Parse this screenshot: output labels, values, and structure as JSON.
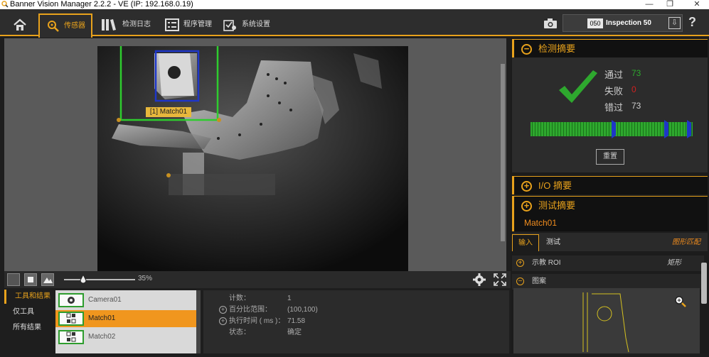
{
  "window": {
    "title": "Banner Vision Manager 2.2.2 - VE (IP: 192.168.0.19)",
    "minimize": "—",
    "restore": "❐",
    "close": "✕"
  },
  "toolbar": {
    "tabs": [
      {
        "label": "",
        "icon": "home-icon"
      },
      {
        "label": "传感器",
        "icon": "sensor-search-icon"
      },
      {
        "label": "检测日志",
        "icon": "log-books-icon"
      },
      {
        "label": "程序管理",
        "icon": "program-list-icon"
      },
      {
        "label": "系统设置",
        "icon": "system-settings-icon"
      }
    ],
    "inspection_number": "050",
    "inspection_name": "Inspection 50",
    "download": "⇩",
    "help": "?"
  },
  "viewer": {
    "roi_label": "[1] Match01",
    "zoom": "35%"
  },
  "left_tabs": [
    "工具和结果",
    "仅工具",
    "所有结果"
  ],
  "tools": [
    {
      "name": "Camera01",
      "icon": "camera-tool-icon"
    },
    {
      "name": "Match01",
      "icon": "match-tool-icon"
    },
    {
      "name": "Match02",
      "icon": "match-tool-icon"
    }
  ],
  "tool_detail": [
    {
      "key": "计数：",
      "value": "1",
      "expand": false
    },
    {
      "key": "百分比范围：",
      "value": "(100,100)",
      "expand": true
    },
    {
      "key": "执行时间 ( ms )：",
      "value": "71.58",
      "expand": true
    },
    {
      "key": "状态：",
      "value": "确定",
      "expand": false
    }
  ],
  "summary": {
    "title": "检测摘要",
    "pass_label": "通过",
    "pass_value": "73",
    "fail_label": "失败",
    "fail_value": "0",
    "miss_label": "错过",
    "miss_value": "73",
    "reset": "重置",
    "colors": {
      "pass": "#2ea82e",
      "fail": "#d02020",
      "miss": "#cccccc",
      "accent": "#e8a21c"
    }
  },
  "io_summary": {
    "title": "I/O 摘要"
  },
  "test_summary": {
    "title": "测试摘要"
  },
  "tool_panel": {
    "tool_name": "Match01",
    "tabs": [
      "输入",
      "测试"
    ],
    "tool_type": "图形匹配",
    "sections": [
      {
        "label": "示教 ROI",
        "value": "矩形",
        "expanded": false
      },
      {
        "label": "图案",
        "value": "",
        "expanded": true
      }
    ]
  }
}
